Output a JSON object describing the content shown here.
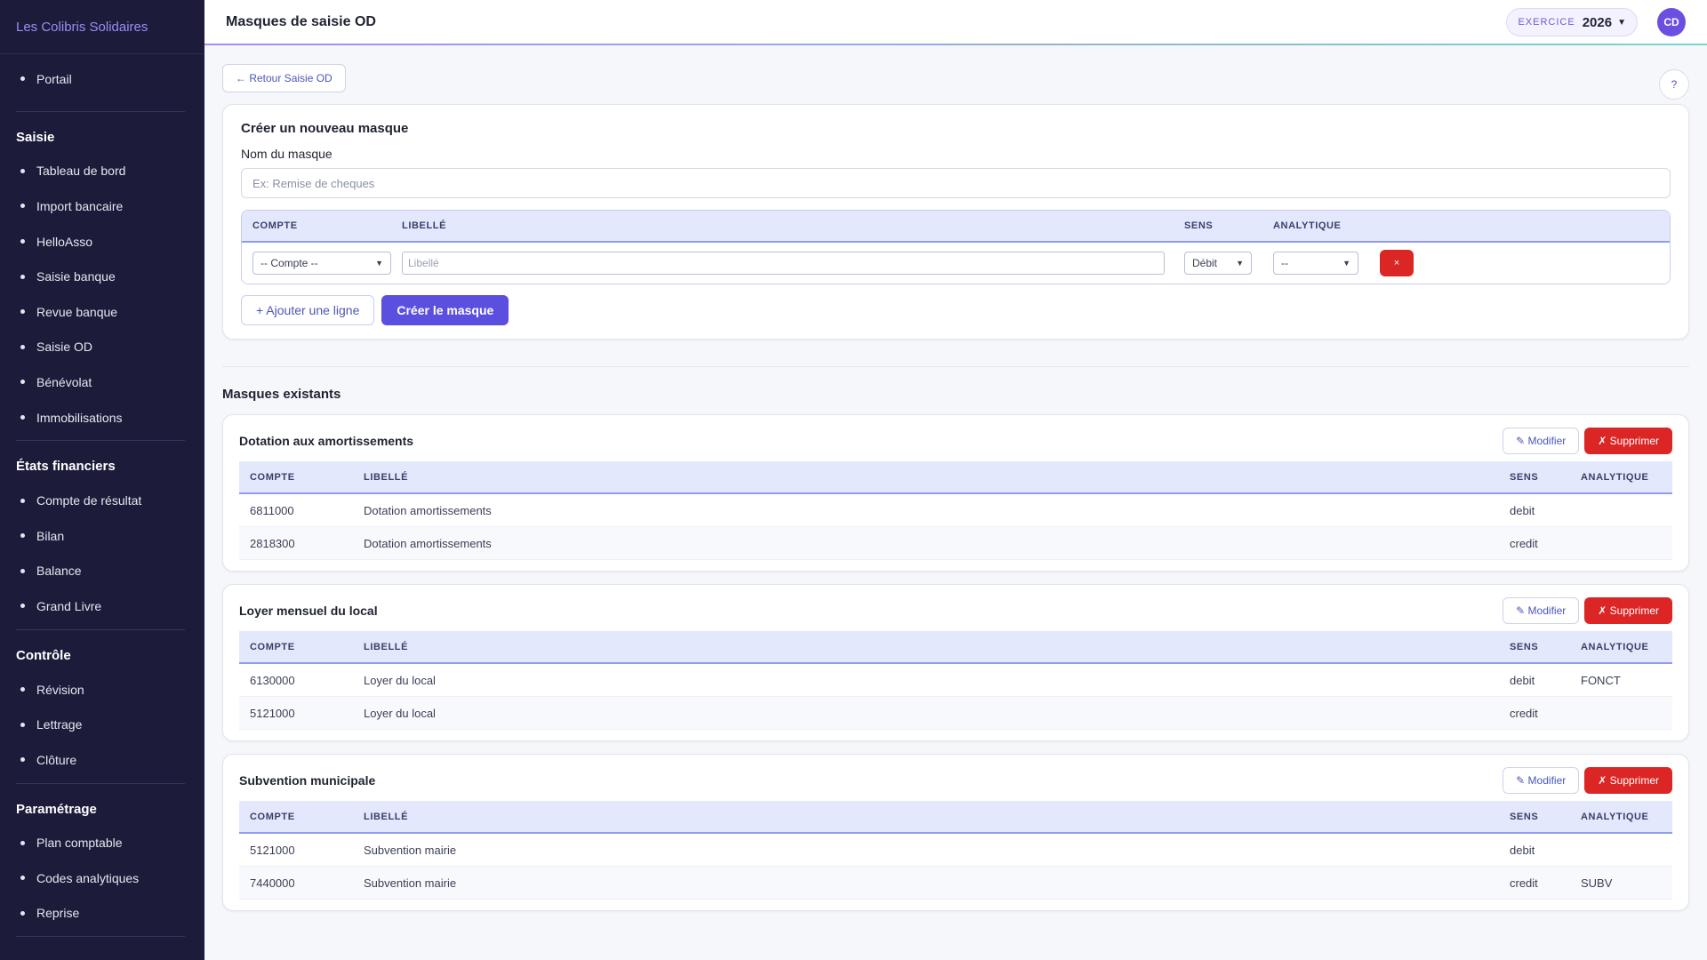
{
  "app": {
    "name": "Les Colibris Solidaires",
    "page_title": "Masques de saisie OD"
  },
  "header": {
    "exercice_label": "EXERCICE",
    "exercice_value": "2026",
    "avatar_initials": "CD"
  },
  "sidebar": {
    "top_items": [
      "Portail"
    ],
    "groups": [
      {
        "title": "Saisie",
        "items": [
          "Tableau de bord",
          "Import bancaire",
          "HelloAsso",
          "Saisie banque",
          "Revue banque",
          "Saisie OD",
          "Bénévolat",
          "Immobilisations"
        ]
      },
      {
        "title": "États financiers",
        "items": [
          "Compte de résultat",
          "Bilan",
          "Balance",
          "Grand Livre"
        ]
      },
      {
        "title": "Contrôle",
        "items": [
          "Révision",
          "Lettrage",
          "Clôture"
        ]
      },
      {
        "title": "Paramétrage",
        "items": [
          "Plan comptable",
          "Codes analytiques",
          "Reprise"
        ]
      }
    ]
  },
  "main": {
    "back_label": "← Retour Saisie OD",
    "help_label": "?",
    "create": {
      "title": "Créer un nouveau masque",
      "name_label": "Nom du masque",
      "name_placeholder": "Ex: Remise de cheques",
      "columns": [
        "COMPTE",
        "LIBELLÉ",
        "SENS",
        "ANALYTIQUE"
      ],
      "row": {
        "compte": "-- Compte --",
        "libelle_placeholder": "Libellé",
        "sens": "Débit",
        "analytique": "--",
        "delete_label": "×"
      },
      "add_line_label": "+ Ajouter une ligne",
      "create_label": "Créer le masque"
    },
    "existing_title": "Masques existants",
    "masks_columns": [
      "COMPTE",
      "LIBELLÉ",
      "SENS",
      "ANALYTIQUE"
    ],
    "modify_label": "✎ Modifier",
    "delete_label": "✗ Supprimer",
    "masks": [
      {
        "title": "Dotation aux amortissements",
        "rows": [
          {
            "compte": "6811000",
            "libelle": "Dotation amortissements",
            "sens": "debit",
            "analytique": ""
          },
          {
            "compte": "2818300",
            "libelle": "Dotation amortissements",
            "sens": "credit",
            "analytique": ""
          }
        ]
      },
      {
        "title": "Loyer mensuel du local",
        "rows": [
          {
            "compte": "6130000",
            "libelle": "Loyer du local",
            "sens": "debit",
            "analytique": "FONCT"
          },
          {
            "compte": "5121000",
            "libelle": "Loyer du local",
            "sens": "credit",
            "analytique": ""
          }
        ]
      },
      {
        "title": "Subvention municipale",
        "rows": [
          {
            "compte": "5121000",
            "libelle": "Subvention mairie",
            "sens": "debit",
            "analytique": ""
          },
          {
            "compte": "7440000",
            "libelle": "Subvention mairie",
            "sens": "credit",
            "analytique": "SUBV"
          }
        ]
      }
    ]
  }
}
